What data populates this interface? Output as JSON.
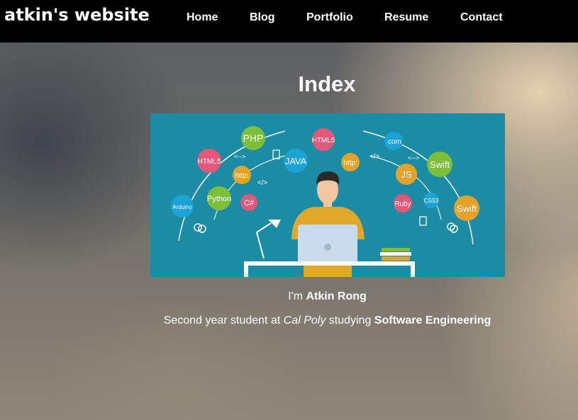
{
  "site": {
    "title": "atkin's website"
  },
  "nav": {
    "items": [
      {
        "label": "Home"
      },
      {
        "label": "Blog"
      },
      {
        "label": "Portfolio"
      },
      {
        "label": "Resume"
      },
      {
        "label": "Contact"
      }
    ]
  },
  "main": {
    "title": "Index",
    "hero_image": {
      "bubbles": [
        "PHP",
        "HTML5",
        "JAVA",
        "http:",
        "HTML5",
        "http:",
        "Python",
        "C#",
        "Arduino",
        ".com",
        "Swift",
        "JS",
        "Ruby",
        "CSS3",
        "Swift"
      ],
      "code_marks": [
        "<-->",
        "</>",
        "</>",
        "<-->"
      ]
    },
    "intro": {
      "prefix": "I'm ",
      "name": "Atkin Rong"
    },
    "bio": {
      "part1": "Second year student at ",
      "school": "Cal Poly",
      "part2": " studying ",
      "major": "Software Engineering"
    }
  },
  "colors": {
    "navbar": "#000000",
    "hero_background": "#1b8ca3",
    "bubble_green": "#7cbf3a",
    "bubble_pink": "#e2577a",
    "bubble_orange": "#e6a12a",
    "bubble_blue": "#1aa3d6"
  }
}
